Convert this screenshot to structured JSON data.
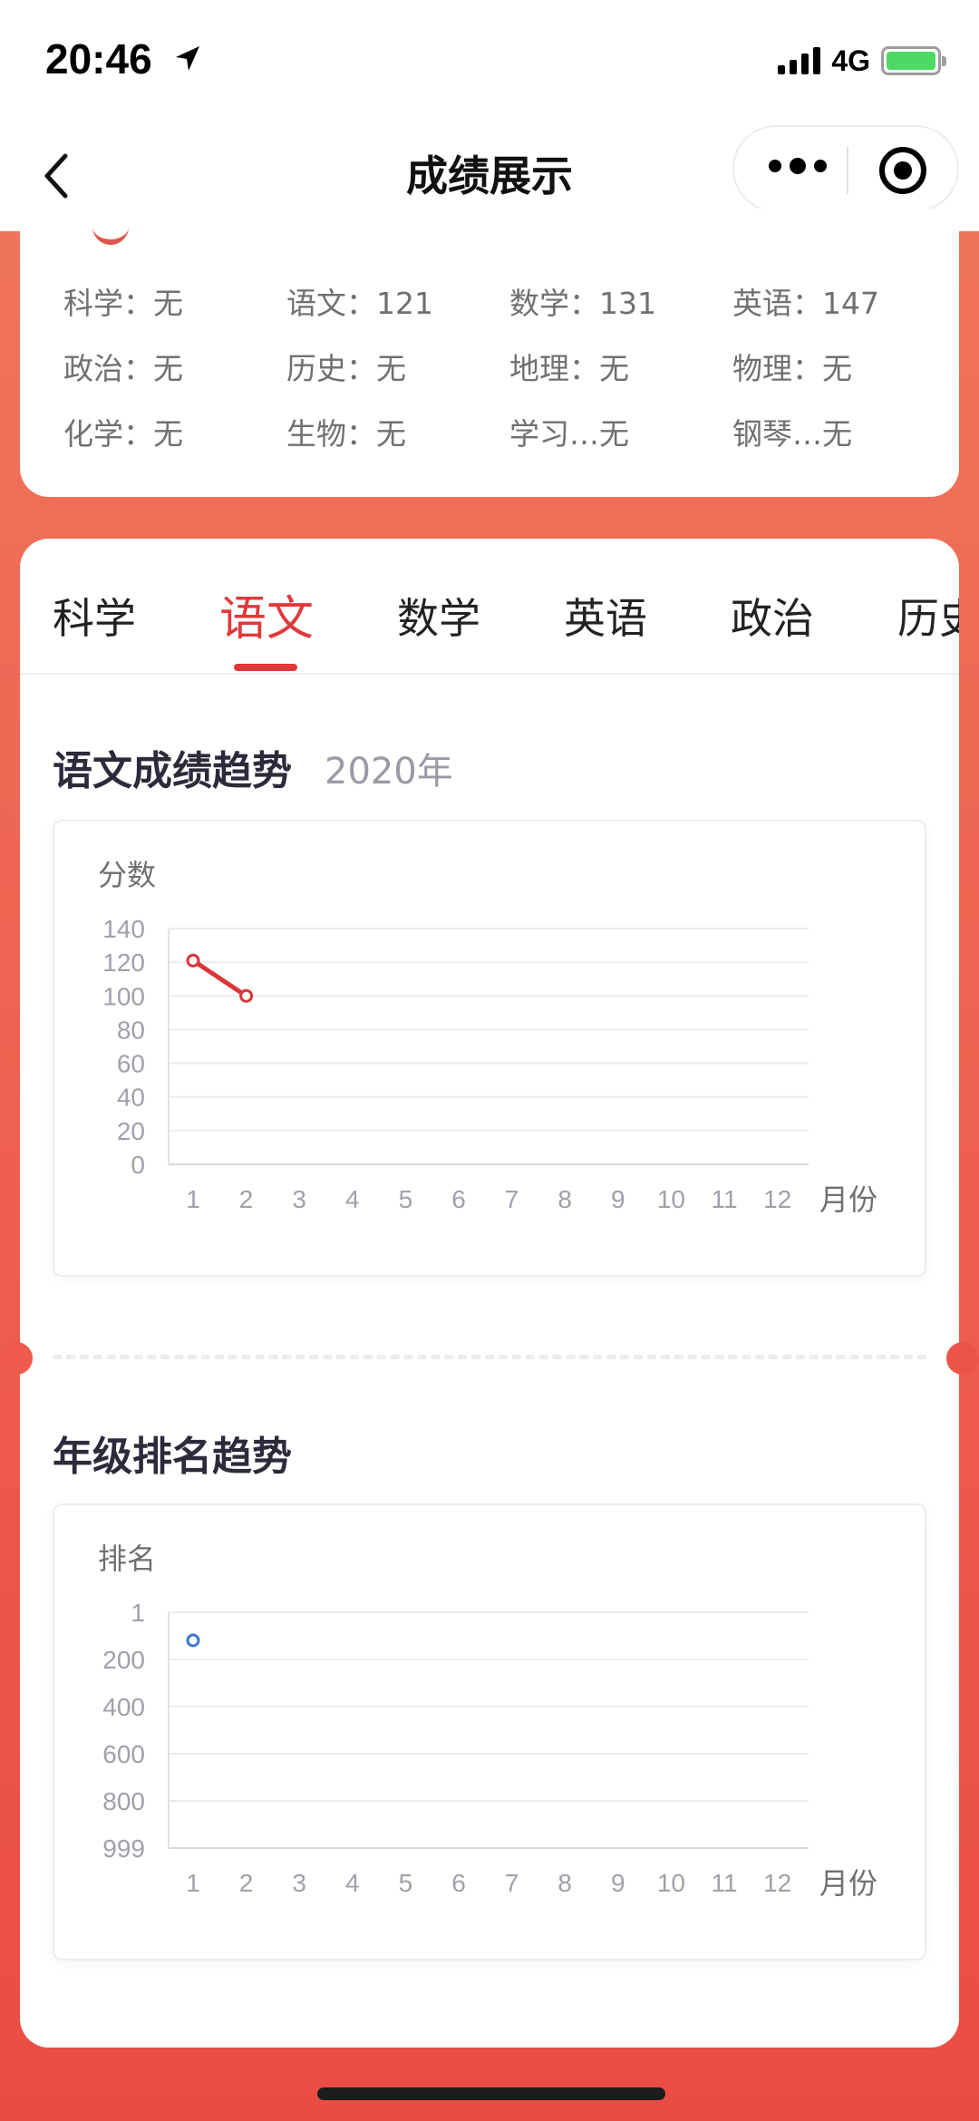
{
  "status": {
    "time": "20:46",
    "network": "4G",
    "battery_level": 1.0
  },
  "nav": {
    "title": "成绩展示"
  },
  "summary": {
    "scores": [
      "科学：无",
      "语文：121",
      "数学：131",
      "英语：147",
      "政治：无",
      "历史：无",
      "地理：无",
      "物理：无",
      "化学：无",
      "生物：无",
      "学习…无",
      "钢琴…无"
    ]
  },
  "tabs": {
    "items": [
      "科学",
      "语文",
      "数学",
      "英语",
      "政治",
      "历史"
    ],
    "active_index": 1
  },
  "score_section": {
    "title": "语文成绩趋势",
    "year": "2020年"
  },
  "rank_section": {
    "title": "年级排名趋势"
  },
  "colors": {
    "accent": "#e0393b",
    "rank_marker": "#3f78c8"
  },
  "chart_data": [
    {
      "type": "line",
      "ylabel": "分数",
      "xlabel": "月份",
      "x_ticks": [
        "1",
        "2",
        "3",
        "4",
        "5",
        "6",
        "7",
        "8",
        "9",
        "10",
        "11",
        "12"
      ],
      "y_ticks": [
        "140",
        "120",
        "100",
        "80",
        "60",
        "40",
        "20",
        "0"
      ],
      "ylim": [
        0,
        140
      ],
      "series": [
        {
          "x": [
            1,
            2
          ],
          "values": [
            121,
            100
          ],
          "color": "#d9363a"
        }
      ],
      "grid": true
    },
    {
      "type": "scatter",
      "ylabel": "排名",
      "xlabel": "月份",
      "x_ticks": [
        "1",
        "2",
        "3",
        "4",
        "5",
        "6",
        "7",
        "8",
        "9",
        "10",
        "11",
        "12"
      ],
      "y_ticks": [
        "1",
        "200",
        "400",
        "600",
        "800",
        "999"
      ],
      "ylim": [
        1,
        999
      ],
      "inverted_y": true,
      "series": [
        {
          "x": [
            1
          ],
          "values": [
            120
          ],
          "color": "#3f78c8"
        }
      ],
      "grid": true
    }
  ]
}
